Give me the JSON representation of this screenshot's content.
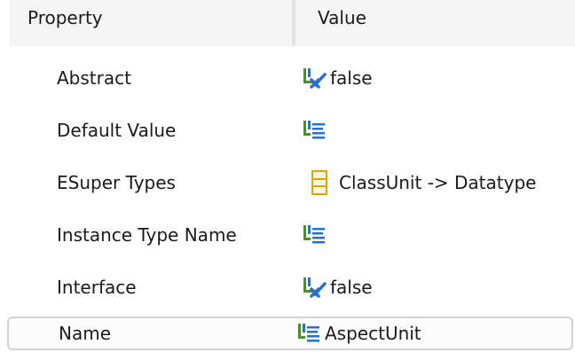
{
  "header": {
    "property_label": "Property",
    "value_label": "Value"
  },
  "rows": [
    {
      "property": "Abstract",
      "value": "false",
      "icon": "boolean-checkbox-icon"
    },
    {
      "property": "Default Value",
      "value": "",
      "icon": "text-property-icon"
    },
    {
      "property": "ESuper Types",
      "value": "ClassUnit -> Datatype",
      "icon": "class-type-icon"
    },
    {
      "property": "Instance Type Name",
      "value": "",
      "icon": "text-property-icon"
    },
    {
      "property": "Interface",
      "value": "false",
      "icon": "boolean-checkbox-icon"
    },
    {
      "property": "Name",
      "value": "AspectUnit",
      "icon": "text-property-icon"
    }
  ],
  "colors": {
    "header_bg": "#f5f5f5",
    "separator": "#e2e2e2",
    "selection_border": "#d3d3d3",
    "icon_green": "#4a8f2a",
    "icon_blue": "#2a6fc9",
    "icon_yellow": "#d9a300"
  }
}
